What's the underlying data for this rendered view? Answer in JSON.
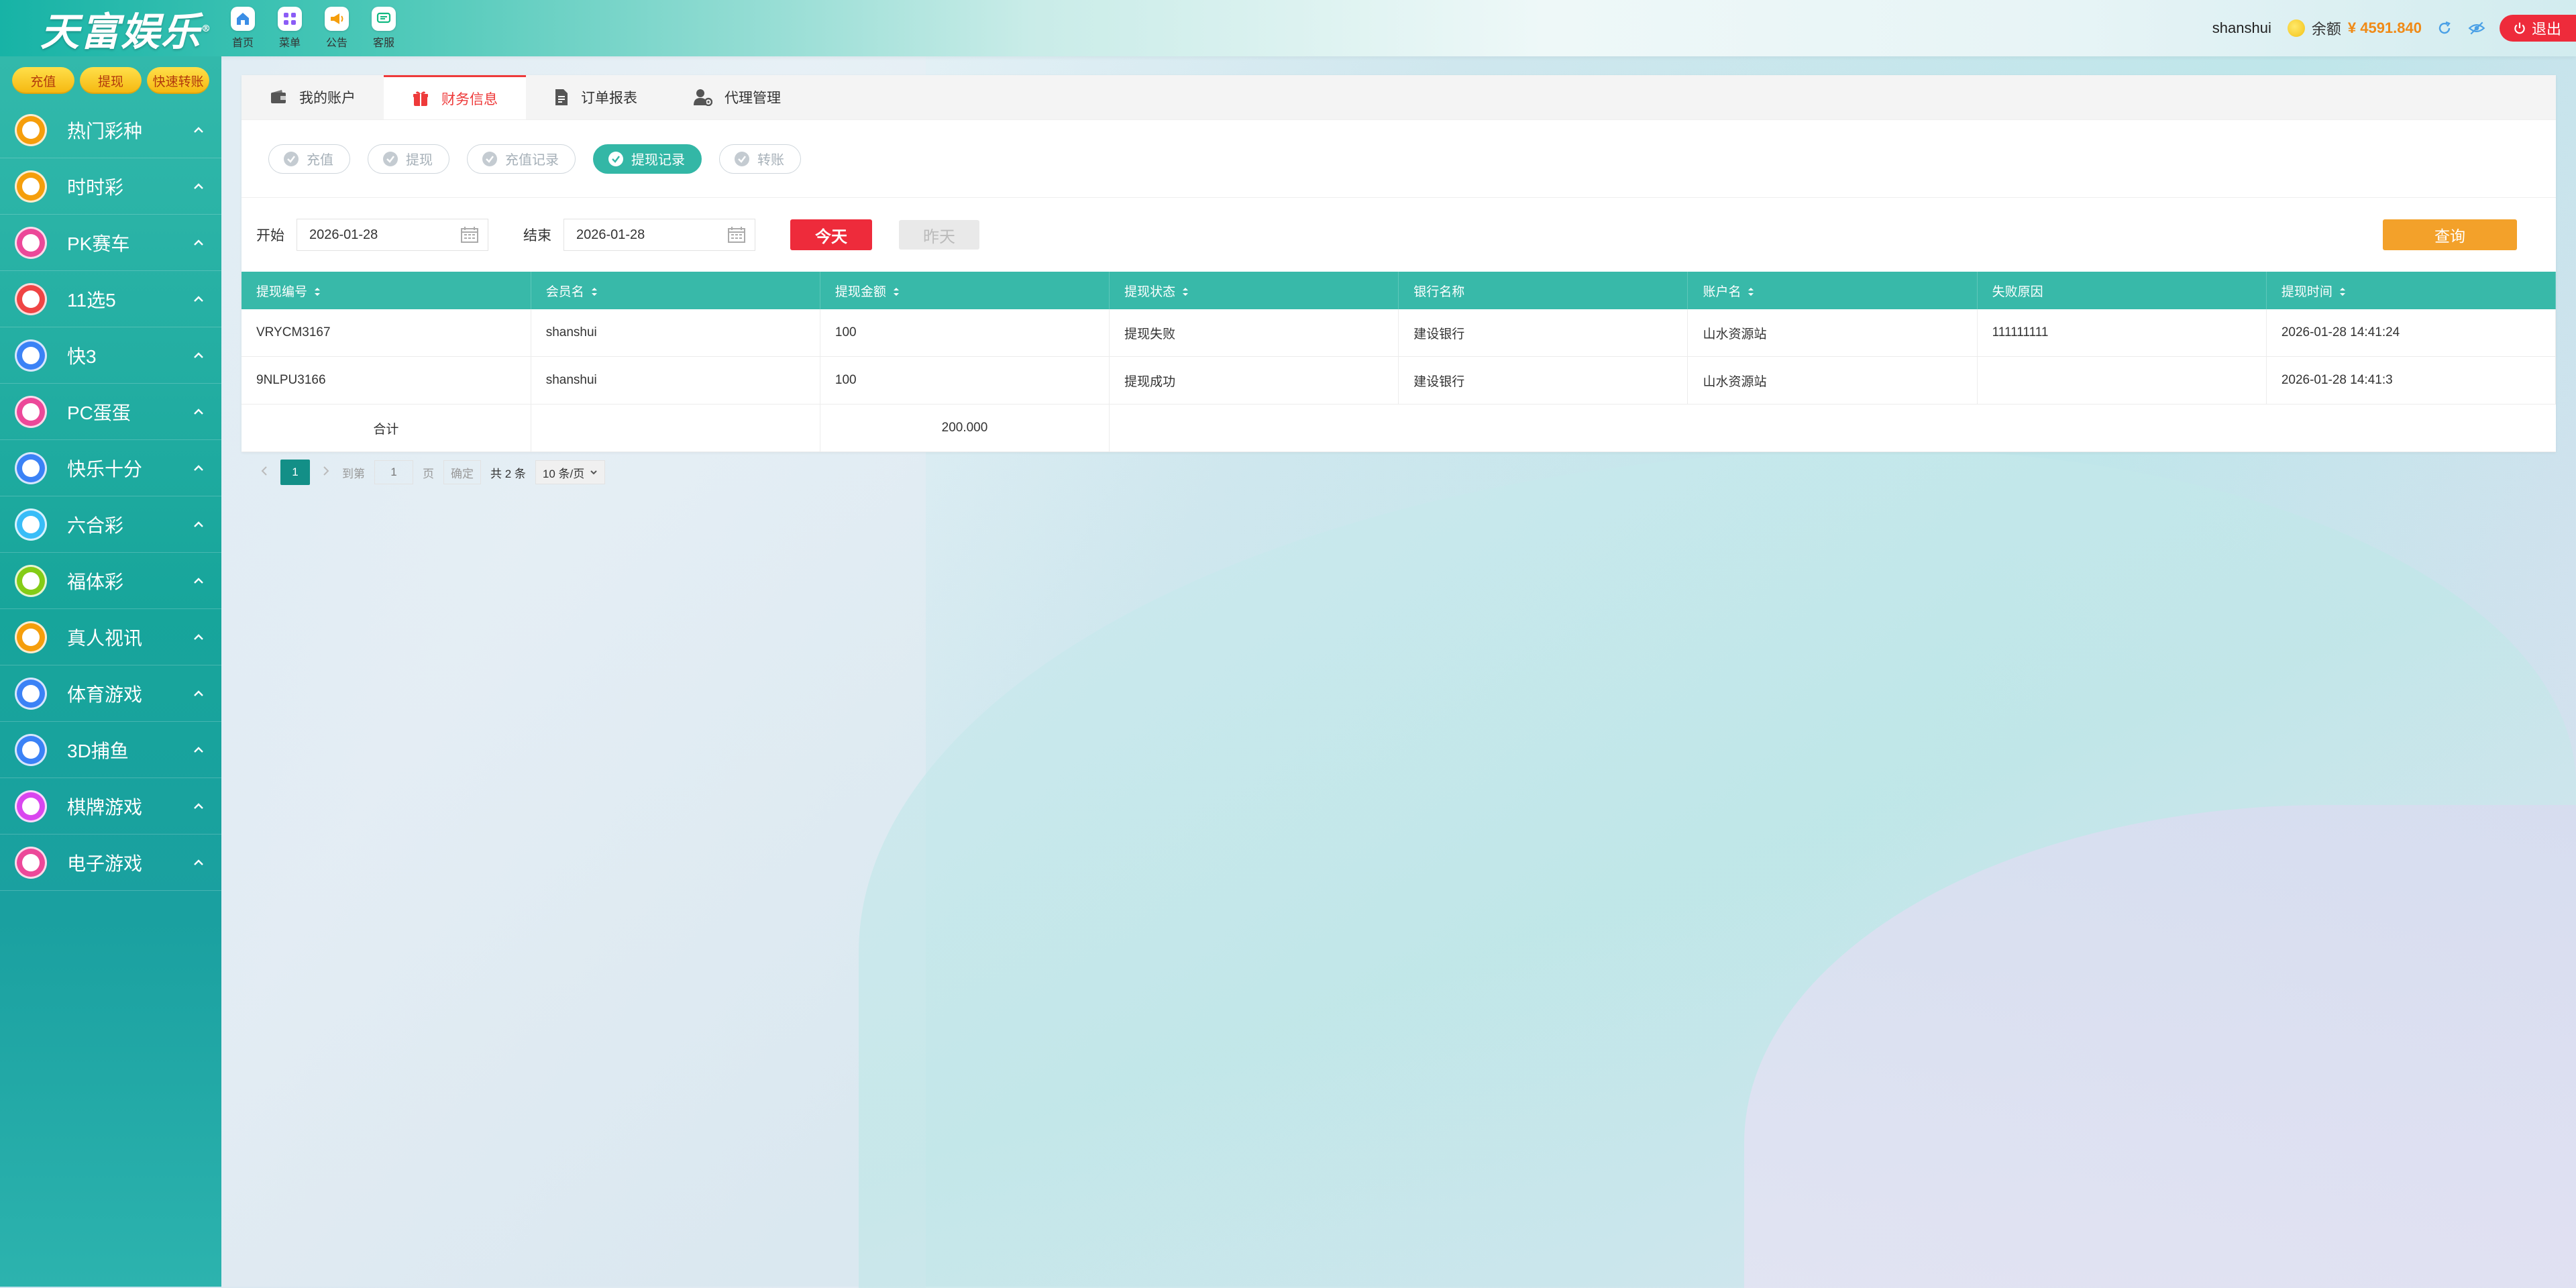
{
  "brand": {
    "logo_text": "天富娱乐",
    "logo_mark": "®"
  },
  "topnav": [
    {
      "label": "首页",
      "icon": "home-icon",
      "color": "#3a8ee6"
    },
    {
      "label": "菜单",
      "icon": "grid-icon",
      "color": "#8b5cf6"
    },
    {
      "label": "公告",
      "icon": "megaphone-icon",
      "color": "#f59e0b"
    },
    {
      "label": "客服",
      "icon": "chat-icon",
      "color": "#10b981"
    }
  ],
  "header": {
    "username": "shanshui",
    "balance_label": "余额",
    "balance_value": "¥ 4591.840",
    "logout_label": "退出"
  },
  "sidebar": {
    "quick_buttons": [
      "充值",
      "提现",
      "快速转账"
    ],
    "items": [
      {
        "label": "热门彩种",
        "color": "#f59e0b"
      },
      {
        "label": "时时彩",
        "color": "#f59e0b"
      },
      {
        "label": "PK赛车",
        "color": "#ec4899"
      },
      {
        "label": "11选5",
        "color": "#ef4444"
      },
      {
        "label": "快3",
        "color": "#3b82f6"
      },
      {
        "label": "PC蛋蛋",
        "color": "#ec4899"
      },
      {
        "label": "快乐十分",
        "color": "#3b82f6"
      },
      {
        "label": "六合彩",
        "color": "#38bdf8"
      },
      {
        "label": "福体彩",
        "color": "#84cc16"
      },
      {
        "label": "真人视讯",
        "color": "#f59e0b"
      },
      {
        "label": "体育游戏",
        "color": "#3b82f6"
      },
      {
        "label": "3D捕鱼",
        "color": "#3b82f6"
      },
      {
        "label": "棋牌游戏",
        "color": "#d946ef"
      },
      {
        "label": "电子游戏",
        "color": "#ec4899"
      }
    ]
  },
  "tabs": [
    {
      "label": "我的账户",
      "icon": "wallet-icon",
      "active": false
    },
    {
      "label": "财务信息",
      "icon": "gift-icon",
      "active": true
    },
    {
      "label": "订单报表",
      "icon": "document-icon",
      "active": false
    },
    {
      "label": "代理管理",
      "icon": "user-gear-icon",
      "active": false
    }
  ],
  "subtabs": [
    {
      "label": "充值",
      "active": false
    },
    {
      "label": "提现",
      "active": false
    },
    {
      "label": "充值记录",
      "active": false
    },
    {
      "label": "提现记录",
      "active": true
    },
    {
      "label": "转账",
      "active": false
    }
  ],
  "filters": {
    "start_label": "开始",
    "start_value": "2026-01-28",
    "end_label": "结束",
    "end_value": "2026-01-28",
    "today_label": "今天",
    "yesterday_label": "昨天",
    "query_label": "查询"
  },
  "table": {
    "columns": [
      {
        "label": "提现编号",
        "sortable": true
      },
      {
        "label": "会员名",
        "sortable": true
      },
      {
        "label": "提现金额",
        "sortable": true
      },
      {
        "label": "提现状态",
        "sortable": true
      },
      {
        "label": "银行名称",
        "sortable": false
      },
      {
        "label": "账户名",
        "sortable": true
      },
      {
        "label": "失败原因",
        "sortable": false
      },
      {
        "label": "提现时间",
        "sortable": true
      }
    ],
    "rows": [
      [
        "VRYCM3167",
        "shanshui",
        "100",
        "提现失败",
        "建设银行",
        "山水资源站",
        "111111111",
        "2026-01-28 14:41:24"
      ],
      [
        "9NLPU3166",
        "shanshui",
        "100",
        "提现成功",
        "建设银行",
        "山水资源站",
        "",
        "2026-01-28 14:41:3"
      ]
    ],
    "summary_label": "合计",
    "summary_value": "200.000"
  },
  "pager": {
    "current_page": "1",
    "goto_label": "到第",
    "goto_value": "1",
    "page_unit": "页",
    "confirm_label": "确定",
    "total_label": "共 2 条",
    "page_size_label": "10 条/页"
  }
}
